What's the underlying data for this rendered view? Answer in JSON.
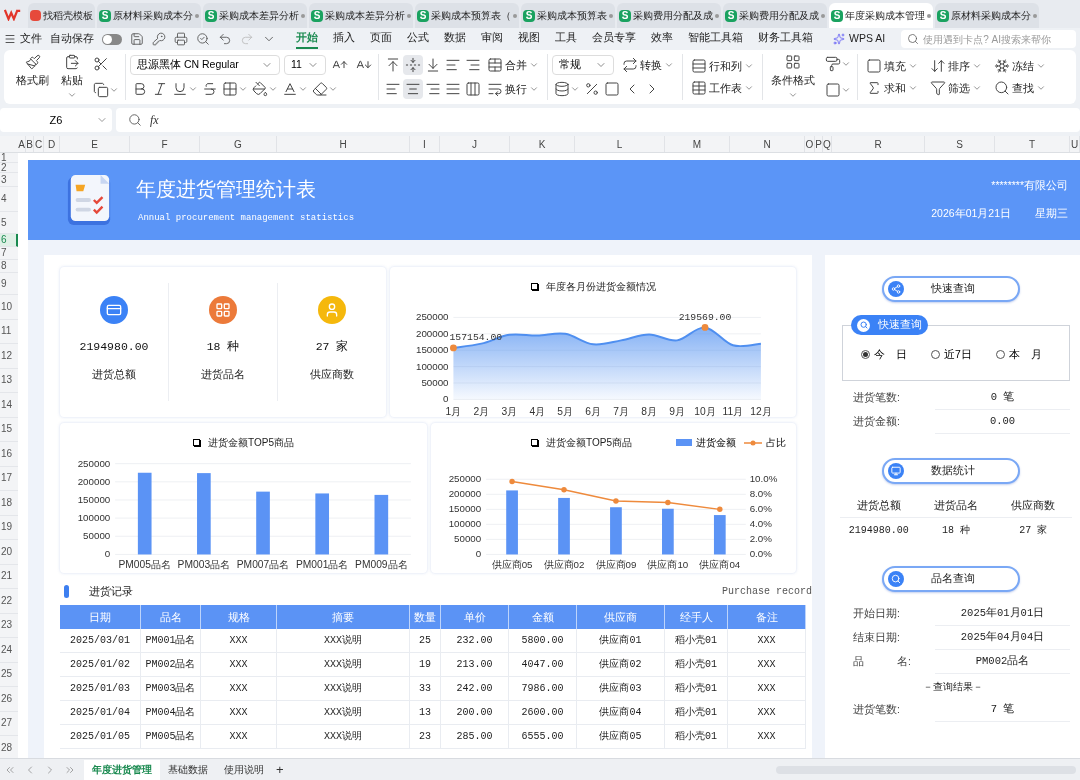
{
  "doc_tabs": [
    {
      "kind": "template",
      "title": "找稻壳模板",
      "selected": false
    },
    {
      "kind": "sheet",
      "badge": "S",
      "title": "原材料采购成本分",
      "selected": false
    },
    {
      "kind": "sheet",
      "badge": "S",
      "title": "采购成本差异分析",
      "selected": false
    },
    {
      "kind": "sheet",
      "badge": "S",
      "title": "采购成本差异分析",
      "selected": false
    },
    {
      "kind": "sheet",
      "badge": "S",
      "title": "采购成本预算表（",
      "selected": false
    },
    {
      "kind": "sheet",
      "badge": "S",
      "title": "采购成本预算表",
      "selected": false
    },
    {
      "kind": "sheet",
      "badge": "S",
      "title": "采购费用分配及成",
      "selected": false
    },
    {
      "kind": "sheet",
      "badge": "S",
      "title": "采购费用分配及成",
      "selected": false
    },
    {
      "kind": "sheet",
      "badge": "S",
      "title": "年度采购成本管理",
      "selected": true
    },
    {
      "kind": "sheet",
      "badge": "S",
      "title": "原材料采购成本分",
      "selected": false
    }
  ],
  "menu": {
    "file": "文件",
    "autosave_label": "自动保存",
    "autosave_on": false,
    "tabs": [
      {
        "label": "开始",
        "selected": true
      },
      {
        "label": "插入",
        "selected": false
      },
      {
        "label": "页面",
        "selected": false
      },
      {
        "label": "公式",
        "selected": false
      },
      {
        "label": "数据",
        "selected": false
      },
      {
        "label": "审阅",
        "selected": false
      },
      {
        "label": "视图",
        "selected": false
      },
      {
        "label": "工具",
        "selected": false
      },
      {
        "label": "会员专享",
        "selected": false
      },
      {
        "label": "效率",
        "selected": false
      },
      {
        "label": "智能工具箱",
        "selected": false
      },
      {
        "label": "财务工具箱",
        "selected": false
      }
    ],
    "ai_label": "WPS AI",
    "search": {
      "placeholder": "使用遇到卡点? AI搜索来帮你"
    }
  },
  "ribbon": {
    "format_painter": "格式刷",
    "paste": "粘贴",
    "font": "思源黑体 CN Regular",
    "size": "11",
    "wrap": "换行",
    "merge": "合并",
    "number_format": "常规",
    "convert": "转换",
    "rows_cols": "行和列",
    "worksheet": "工作表",
    "cond_format": "条件格式",
    "fill": "填充",
    "sort": "排序",
    "freeze": "冻结",
    "sum": "求和",
    "filter": "筛选",
    "find": "查找"
  },
  "formula_bar": {
    "cell": "Z6",
    "fx": "fx"
  },
  "columns": [
    "A",
    "B",
    "C",
    "D",
    "E",
    "F",
    "G",
    "H",
    "I",
    "J",
    "K",
    "L",
    "M",
    "N",
    "O",
    "P",
    "Q",
    "R",
    "S",
    "T",
    "U"
  ],
  "rows": [
    {
      "label": "1",
      "selected": false
    },
    {
      "label": "2",
      "selected": false
    },
    {
      "label": "3",
      "selected": false
    },
    {
      "label": "4",
      "selected": false
    },
    {
      "label": "5",
      "selected": false
    },
    {
      "label": "6",
      "selected": true
    },
    {
      "label": "7",
      "selected": false
    },
    {
      "label": "8",
      "selected": false
    },
    {
      "label": "9",
      "selected": false
    },
    {
      "label": "10",
      "selected": false
    },
    {
      "label": "11",
      "selected": false
    },
    {
      "label": "12",
      "selected": false
    },
    {
      "label": "13",
      "selected": false
    },
    {
      "label": "14",
      "selected": false
    },
    {
      "label": "15",
      "selected": false
    },
    {
      "label": "16",
      "selected": false
    },
    {
      "label": "17",
      "selected": false
    },
    {
      "label": "18",
      "selected": false
    },
    {
      "label": "19",
      "selected": false
    },
    {
      "label": "20",
      "selected": false
    },
    {
      "label": "21",
      "selected": false
    },
    {
      "label": "22",
      "selected": false
    },
    {
      "label": "23",
      "selected": false
    },
    {
      "label": "24",
      "selected": false
    },
    {
      "label": "25",
      "selected": false
    },
    {
      "label": "26",
      "selected": false
    },
    {
      "label": "27",
      "selected": false
    },
    {
      "label": "28",
      "selected": false
    }
  ],
  "banner": {
    "title": "年度进货管理统计表",
    "subtitle": "Annual procurement management statistics",
    "company": "********有限公司",
    "date": "2026年01月21日",
    "weekday": "星期三"
  },
  "kpis": [
    {
      "kind": "amount",
      "value": "2194980.00",
      "label": "进货总额"
    },
    {
      "kind": "items",
      "value": "18 种",
      "label": "进货品名"
    },
    {
      "kind": "suppliers",
      "value": "27 家",
      "label": "供应商数"
    }
  ],
  "monthly_chart": {
    "chart_data": {
      "type": "area",
      "title": "年度各月份进货金额情况",
      "categories": [
        "1月",
        "2月",
        "3月",
        "4月",
        "5月",
        "6月",
        "7月",
        "8月",
        "9月",
        "10月",
        "11月",
        "12月"
      ],
      "series": [
        {
          "color": "#4f8ff0",
          "values": [
            157154,
            170000,
            197000,
            195000,
            200000,
            168000,
            180000,
            198000,
            180000,
            219569,
            165000,
            170000
          ]
        }
      ],
      "ylim": [
        0,
        250000
      ],
      "yticks": [
        0,
        50000,
        100000,
        150000,
        200000,
        250000
      ],
      "grid": true,
      "annotations": [
        {
          "x": "1月",
          "y": 157154,
          "text": "157154.00"
        },
        {
          "x": "10月",
          "y": 219569,
          "text": "219569.00"
        }
      ]
    }
  },
  "product_chart": {
    "chart_data": {
      "type": "bar",
      "title": "进货金额TOP5商品",
      "categories": [
        "PM005品名",
        "PM003品名",
        "PM007品名",
        "PM001品名",
        "PM009品名"
      ],
      "series": [
        {
          "color": "#5b93f5",
          "values": [
            225000,
            224000,
            173000,
            168000,
            164000
          ]
        }
      ],
      "ylim": [
        0,
        250000
      ],
      "yticks": [
        0,
        50000,
        100000,
        150000,
        200000,
        250000
      ],
      "grid": true
    }
  },
  "supplier_chart": {
    "chart_data": {
      "type": "bar",
      "title": "进货金额TOP5商品",
      "categories": [
        "供应商05",
        "供应商02",
        "供应商09",
        "供应商10",
        "供应商04"
      ],
      "series": [
        {
          "name": "进货金额",
          "color": "#5b93f5",
          "values": [
            213000,
            188000,
            157000,
            152000,
            131000
          ]
        },
        {
          "name": "占比",
          "type": "line",
          "color": "#ee8a3c",
          "axis": "y2",
          "values": [
            0.097,
            0.086,
            0.071,
            0.069,
            0.06
          ]
        }
      ],
      "ylim": [
        0,
        250000
      ],
      "yticks": [
        0,
        50000,
        100000,
        150000,
        200000,
        250000
      ],
      "grid": true,
      "y2lim": [
        0,
        0.1
      ],
      "y2ticks": [
        {
          "value": 0,
          "label": "0.0%"
        },
        {
          "value": 0.02,
          "label": "2.0%"
        },
        {
          "value": 0.04,
          "label": "4.0%"
        },
        {
          "value": 0.06,
          "label": "6.0%"
        },
        {
          "value": 0.08,
          "label": "8.0%"
        },
        {
          "value": 0.1,
          "label": "10.0%"
        }
      ]
    }
  },
  "records": {
    "title": "进货记录",
    "subtitle": "Purchase record",
    "columns": [
      "日期",
      "品名",
      "规格",
      "摘要",
      "数量",
      "单价",
      "金额",
      "供应商",
      "经手人",
      "备注"
    ],
    "rows": [
      [
        "2025/03/01",
        "PM001品名",
        "XXX",
        "XXX说明",
        "25",
        "232.00",
        "5800.00",
        "供应商01",
        "稻小壳01",
        "XXX"
      ],
      [
        "2025/01/02",
        "PM002品名",
        "XXX",
        "XXX说明",
        "19",
        "213.00",
        "4047.00",
        "供应商02",
        "稻小壳01",
        "XXX"
      ],
      [
        "2025/01/03",
        "PM003品名",
        "XXX",
        "XXX说明",
        "33",
        "242.00",
        "7986.00",
        "供应商03",
        "稻小壳01",
        "XXX"
      ],
      [
        "2025/01/04",
        "PM004品名",
        "XXX",
        "XXX说明",
        "13",
        "200.00",
        "2600.00",
        "供应商04",
        "稻小壳01",
        "XXX"
      ],
      [
        "2025/01/05",
        "PM005品名",
        "XXX",
        "XXX说明",
        "23",
        "285.00",
        "6555.00",
        "供应商05",
        "稻小壳01",
        "XXX"
      ]
    ]
  },
  "side": {
    "quick_button": "快速查询",
    "quick_tab": "快速查询",
    "periods": [
      {
        "label": "今　日",
        "selected": true
      },
      {
        "label": "近7日",
        "selected": false
      },
      {
        "label": "本　月",
        "selected": false
      }
    ],
    "quick_rows": [
      {
        "label": "进货笔数:",
        "value": "0 笔"
      },
      {
        "label": "进货金额:",
        "value": "0.00"
      }
    ],
    "stats_button": "数据统计",
    "stats_headers": [
      "进货总额",
      "进货品名",
      "供应商数"
    ],
    "stats_values": [
      "2194980.00",
      "18 种",
      "27 家"
    ],
    "product_button": "品名查询",
    "product_rows": [
      {
        "label": "开始日期:",
        "value": "2025年01月01日"
      },
      {
        "label": "结束日期:",
        "value": "2025年04月04日"
      },
      {
        "label": "品　　　名:",
        "value": "PM002品名"
      }
    ],
    "result_title": "－查询结果－",
    "result_rows": [
      {
        "label": "进货笔数:",
        "value": "7 笔"
      }
    ]
  },
  "sheet_tabs": [
    {
      "label": "年度进货管理",
      "selected": true
    },
    {
      "label": "基础数据",
      "selected": false
    },
    {
      "label": "使用说明",
      "selected": false
    }
  ],
  "add_sheet": "+"
}
